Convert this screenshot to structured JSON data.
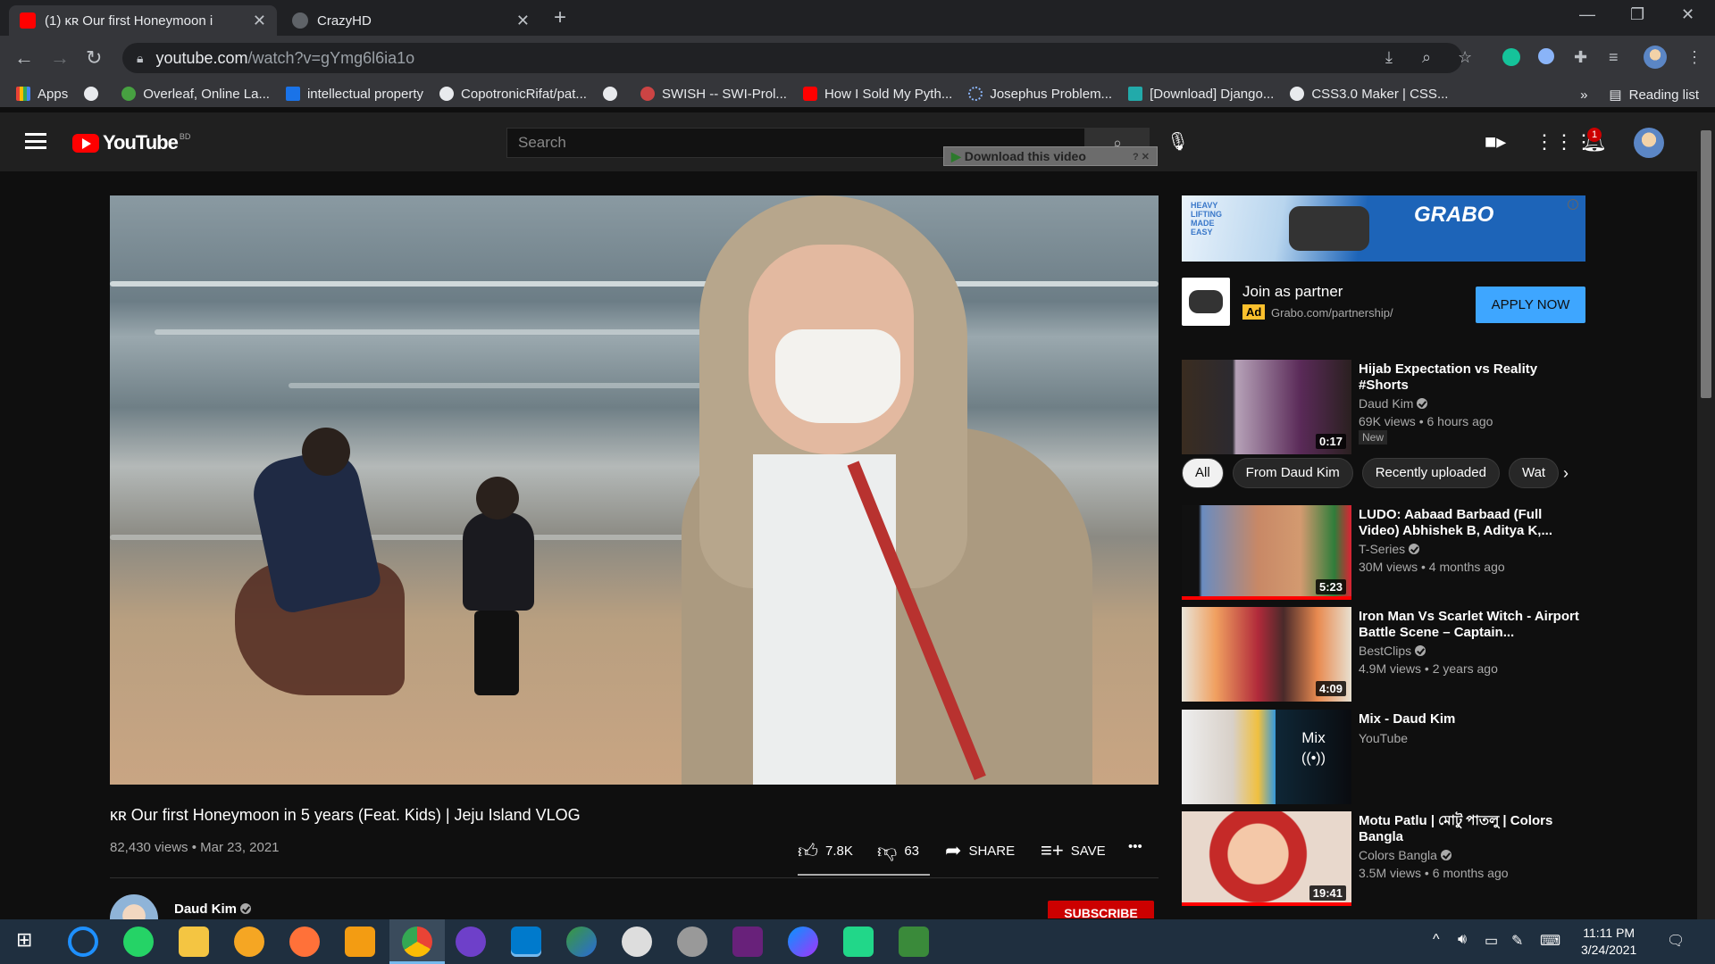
{
  "browser": {
    "tabs": [
      {
        "title": "(1) ᴋʀ Our first Honeymoon i",
        "active": true
      },
      {
        "title": "CrazyHD",
        "active": false
      }
    ],
    "url_host": "youtube.com",
    "url_path": "/watch?v=gYmg6l6ia1o",
    "bookmarks": [
      "Apps",
      "Overleaf, Online La...",
      "intellectual property",
      "CopotronicRifat/pat...",
      "SWISH -- SWI-Prol...",
      "How I Sold My Pyth...",
      "Josephus Problem...",
      "[Download] Django...",
      "CSS3.0 Maker | CSS..."
    ],
    "bookmarks_more": "»",
    "reading_list": "Reading list"
  },
  "youtube": {
    "logo_text": "YouTube",
    "country_code": "BD",
    "search_placeholder": "Search",
    "download_helper": "Download this video",
    "notification_count": "1"
  },
  "video": {
    "title": "ᴋʀ Our first Honeymoon in 5 years (Feat. Kids) | Jeju Island VLOG",
    "views_date": "82,430 views • Mar 23, 2021",
    "likes": "7.8K",
    "dislikes": "63",
    "like_ratio": 0.99,
    "share_label": "SHARE",
    "save_label": "SAVE",
    "more_label": "•••",
    "channel": "Daud Kim",
    "subscribe_label": "SUBSCRIBE"
  },
  "ad": {
    "banner_brand": "GRABO",
    "banner_tag": "HEAVY LIFTING MADE EASY",
    "title": "Join as partner",
    "badge": "Ad",
    "url": "Grabo.com/partnership/",
    "cta": "APPLY NOW"
  },
  "chips": [
    "All",
    "From Daud Kim",
    "Recently uploaded",
    "Wat"
  ],
  "recommendations": [
    {
      "title": "Hijab Expectation vs Reality #Shorts",
      "channel": "Daud Kim",
      "verified": true,
      "meta": "69K views • 6 hours ago",
      "duration": "0:17",
      "badge": "New"
    },
    {
      "title": "LUDO: Aabaad Barbaad (Full Video) Abhishek B, Aditya K,...",
      "channel": "T-Series",
      "verified": true,
      "meta": "30M views • 4 months ago",
      "duration": "5:23",
      "progress": 1.0
    },
    {
      "title": "Iron Man Vs Scarlet Witch - Airport Battle Scene – Captain...",
      "channel": "BestClips",
      "verified": true,
      "meta": "4.9M views • 2 years ago",
      "duration": "4:09"
    },
    {
      "title": "Mix - Daud Kim",
      "channel": "YouTube",
      "verified": false,
      "meta": "",
      "mix_label": "Mix"
    },
    {
      "title": "Motu Patlu | মোটু পাতলু | Colors Bangla",
      "channel": "Colors Bangla",
      "verified": true,
      "meta": "3.5M views • 6 months ago",
      "duration": "19:41",
      "progress": 1.0
    }
  ],
  "taskbar": {
    "time": "11:11 PM",
    "date": "3/24/2021"
  }
}
